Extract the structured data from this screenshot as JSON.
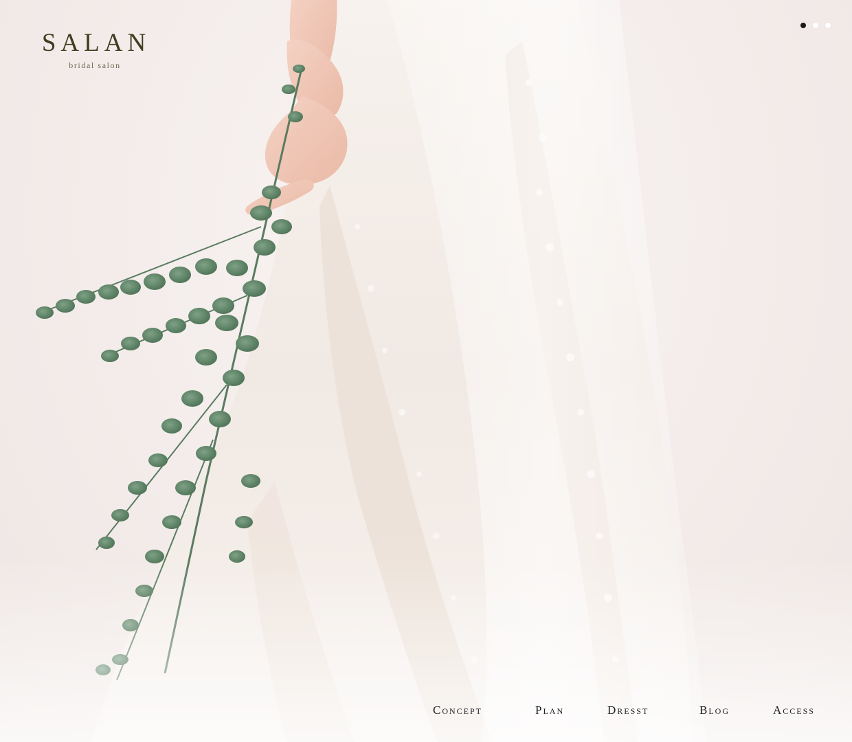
{
  "brand": {
    "name": "SALAN",
    "tagline": "bridal salon",
    "color": "#3f3d1f"
  },
  "slider": {
    "total": 3,
    "active_index": 0,
    "active_color": "#1a1a1a",
    "inactive_color": "#ffffff"
  },
  "nav": {
    "items": [
      {
        "label": "Concept"
      },
      {
        "label": "Plan"
      },
      {
        "label": "Dresst"
      },
      {
        "label": "Blog"
      },
      {
        "label": "Access"
      }
    ]
  },
  "hero": {
    "image": "bride-holding-eucalyptus-bouquet-photo"
  }
}
